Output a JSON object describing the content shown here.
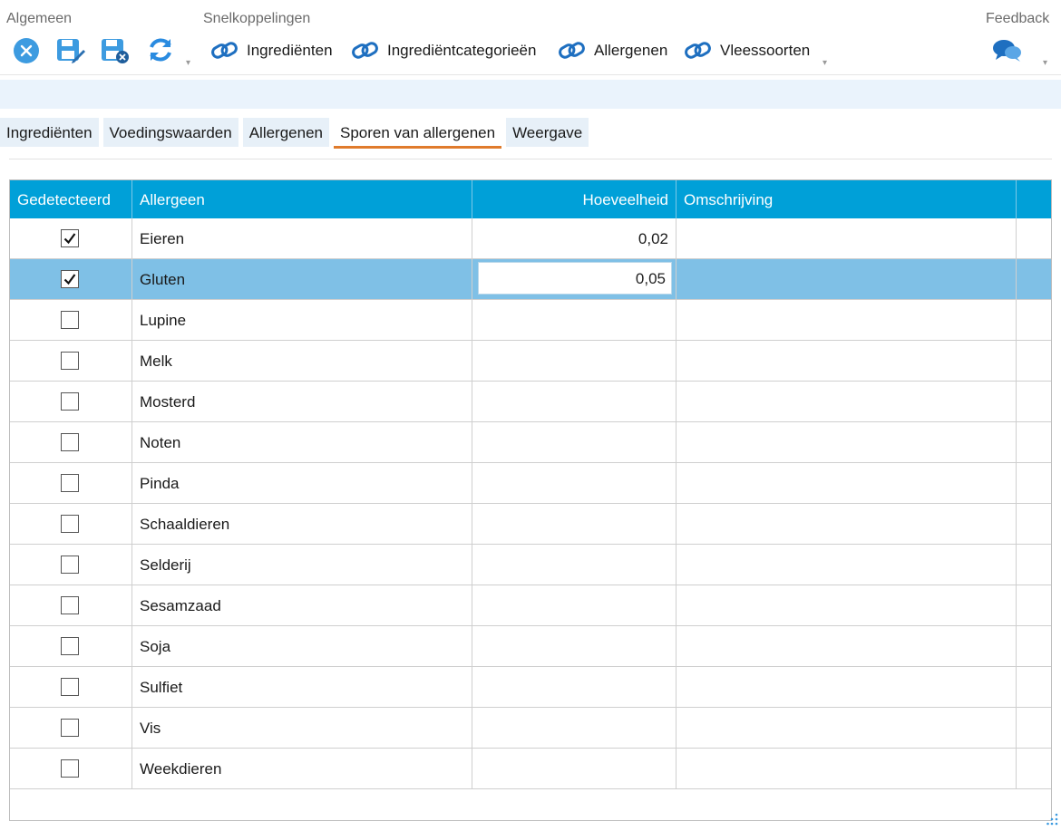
{
  "ribbon": {
    "groups": {
      "algemeen": "Algemeen",
      "snelkoppelingen": "Snelkoppelingen",
      "feedback": "Feedback"
    },
    "links": [
      "Ingrediënten",
      "Ingrediëntcategorieën",
      "Allergenen",
      "Vleessoorten"
    ],
    "icons": [
      "close-icon",
      "save-edit-icon",
      "save-close-icon",
      "refresh-icon",
      "link-icon",
      "feedback-chat-icon"
    ]
  },
  "tabs": [
    "Ingrediënten",
    "Voedingswaarden",
    "Allergenen",
    "Sporen van allergenen",
    "Weergave"
  ],
  "active_tab": "Sporen van allergenen",
  "grid": {
    "columns": [
      "Gedetecteerd",
      "Allergeen",
      "Hoeveelheid",
      "Omschrijving"
    ],
    "rows": [
      {
        "detected": true,
        "name": "Eieren",
        "amount": "0,02",
        "description": ""
      },
      {
        "detected": true,
        "name": "Gluten",
        "amount": "0,05",
        "description": ""
      },
      {
        "detected": false,
        "name": "Lupine",
        "amount": "",
        "description": ""
      },
      {
        "detected": false,
        "name": "Melk",
        "amount": "",
        "description": ""
      },
      {
        "detected": false,
        "name": "Mosterd",
        "amount": "",
        "description": ""
      },
      {
        "detected": false,
        "name": "Noten",
        "amount": "",
        "description": ""
      },
      {
        "detected": false,
        "name": "Pinda",
        "amount": "",
        "description": ""
      },
      {
        "detected": false,
        "name": "Schaaldieren",
        "amount": "",
        "description": ""
      },
      {
        "detected": false,
        "name": "Selderij",
        "amount": "",
        "description": ""
      },
      {
        "detected": false,
        "name": "Sesamzaad",
        "amount": "",
        "description": ""
      },
      {
        "detected": false,
        "name": "Soja",
        "amount": "",
        "description": ""
      },
      {
        "detected": false,
        "name": "Sulfiet",
        "amount": "",
        "description": ""
      },
      {
        "detected": false,
        "name": "Vis",
        "amount": "",
        "description": ""
      },
      {
        "detected": false,
        "name": "Weekdieren",
        "amount": "",
        "description": ""
      }
    ],
    "selected_row": "Gluten"
  },
  "colors": {
    "accent": "#00a0d8",
    "selected_row": "#7fc0e6",
    "active_tab_underline": "#e07b2c",
    "icon_blue": "#1e88d8"
  }
}
